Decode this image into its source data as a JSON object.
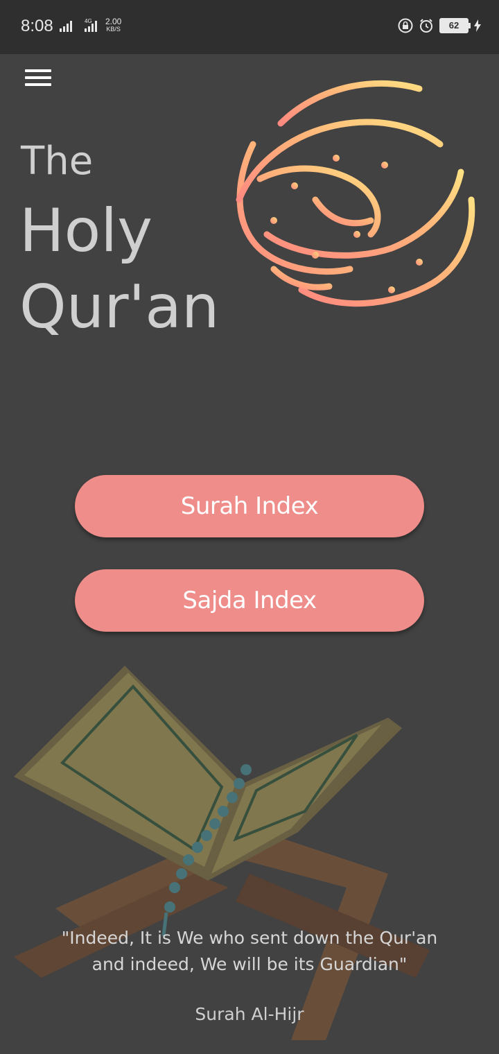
{
  "status_bar": {
    "time": "8:08",
    "network_type": "4G",
    "data_speed_value": "2.00",
    "data_speed_unit": "KB/S",
    "battery_level": "62",
    "icons": [
      "signal-icon",
      "signal-4g-icon",
      "lock-icon",
      "alarm-icon",
      "battery-icon",
      "charging-icon"
    ]
  },
  "header": {
    "menu_icon": "hamburger-menu-icon",
    "title_line1": "The",
    "title_line2": "Holy",
    "title_line3": "Qur'an",
    "logo": "quran-calligraphy-logo"
  },
  "buttons": {
    "surah_index_label": "Surah Index",
    "sajda_index_label": "Sajda Index"
  },
  "footer": {
    "quote_line1": "\"Indeed, It is We who sent down the Qur'an",
    "quote_line2": "and indeed, We will be its Guardian\"",
    "quote_source": "Surah Al-Hijr"
  },
  "colors": {
    "background": "#424242",
    "status_bar": "#2f2f2f",
    "button": "#ee8d8a",
    "title_text": "#cfcfcf",
    "logo_gradient_start": "#ff8a80",
    "logo_gradient_end": "#ffe082"
  }
}
